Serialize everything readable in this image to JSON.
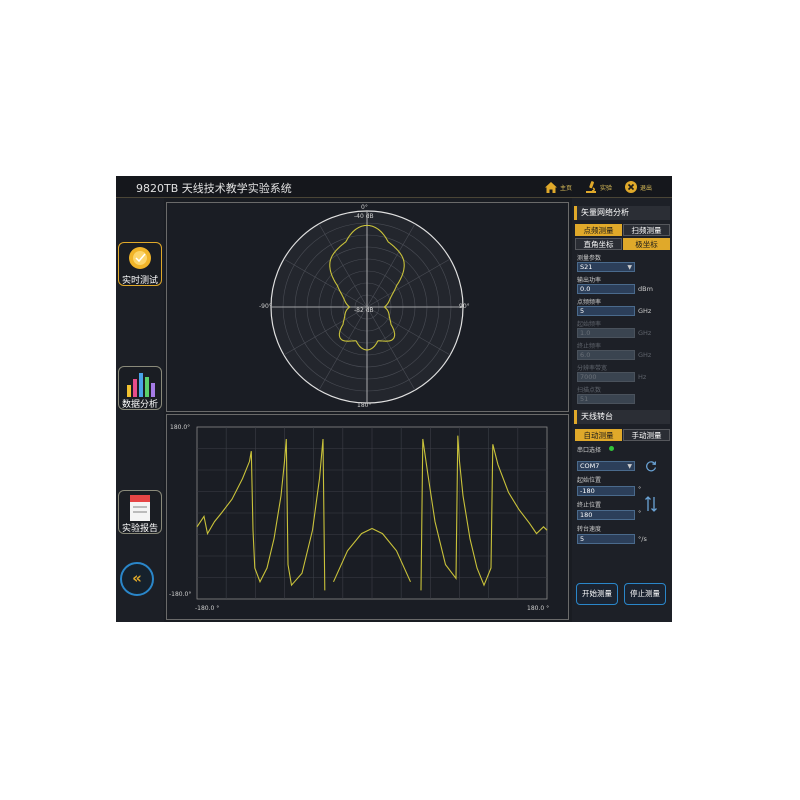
{
  "titlebar": {
    "title": "9820TB 天线技术教学实验系统",
    "home_label": "主页",
    "exp_label": "实验",
    "exit_label": "退出"
  },
  "nav": {
    "items": [
      {
        "label": "实时测试",
        "active": true
      },
      {
        "label": "数据分析",
        "active": false
      },
      {
        "label": "实验报告",
        "active": false
      }
    ],
    "back": "«"
  },
  "polar": {
    "top_angle": "0°",
    "bottom_angle": "180°",
    "left_angle": "-90°",
    "right_angle": "90°",
    "outer_db": "-40 dB",
    "inner_db": "-82 dB"
  },
  "cartesian": {
    "y_max": "180.0°",
    "y_min": "-180.0°",
    "x_min": "-180.0 °",
    "x_max": "180.0 °"
  },
  "vna": {
    "title": "矢量网络分析",
    "tab_point": "点频测量",
    "tab_sweep": "扫频测量",
    "tab_rect": "直角坐标",
    "tab_polar": "极坐标",
    "param_label": "测量参数",
    "param_value": "S21",
    "power_label": "输出功率",
    "power_value": "0.0",
    "power_unit": "dBm",
    "freq_label": "点频频率",
    "freq_value": "5",
    "freq_unit": "GHz",
    "start_label": "起始频率",
    "start_value": "1.0",
    "start_unit": "GHz",
    "stop_label": "终止频率",
    "stop_value": "6.0",
    "stop_unit": "GHz",
    "bw_label": "分辨率带宽",
    "bw_value": "7000",
    "bw_unit": "Hz",
    "points_label": "扫描点数",
    "points_value": "51"
  },
  "turntable": {
    "title": "天线转台",
    "tab_auto": "自动测量",
    "tab_manual": "手动测量",
    "port_label": "串口选择",
    "port_value": "COM7",
    "start_label": "起始位置",
    "start_value": "-180",
    "stop_label": "终止位置",
    "stop_value": "180",
    "speed_label": "转台速度",
    "speed_value": "5",
    "deg_unit": "°",
    "speed_unit": "°/s",
    "start_btn": "开始测量",
    "stop_btn": "停止测量"
  },
  "colors": {
    "accent": "#e0a92a",
    "trace": "#c9c23a",
    "button_border": "#2a86c9",
    "lamp": "#31c43a"
  },
  "icons": {
    "home": "home-icon",
    "experiment": "microscope-icon",
    "exit": "close-circle-icon",
    "refresh": "refresh-icon",
    "swap": "swap-arrows-icon"
  }
}
